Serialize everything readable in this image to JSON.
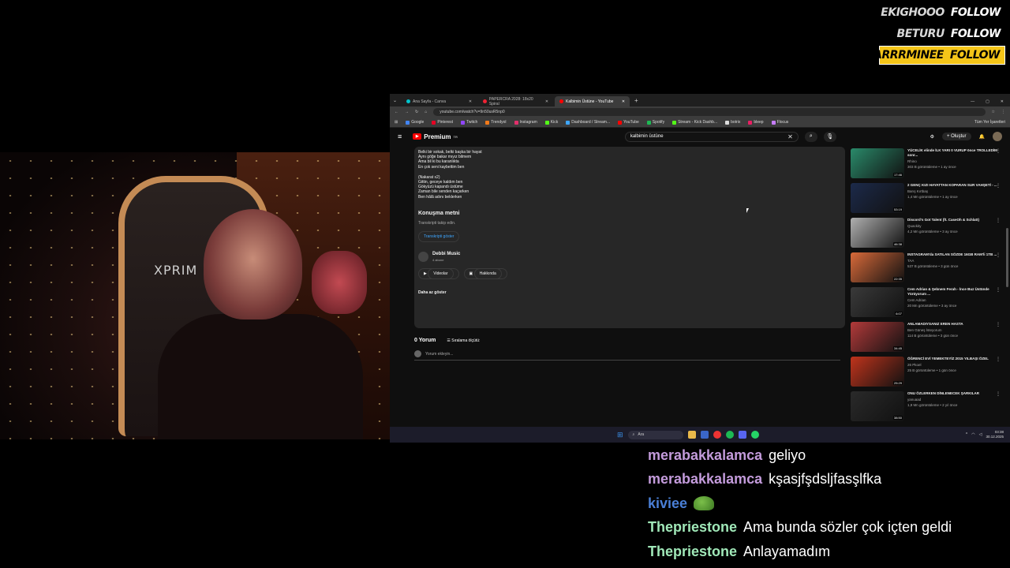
{
  "alerts": [
    {
      "name": "EKIGHOOO",
      "action": "FOLLOW",
      "highlight": false
    },
    {
      "name": "BETURU",
      "action": "FOLLOW",
      "highlight": false
    },
    {
      "name": "NARRRMINEE",
      "action": "FOLLOW",
      "highlight": true
    }
  ],
  "webcam": {
    "chair_brand": "XPRIM"
  },
  "browser": {
    "tabs": [
      {
        "label": "Ana Sayfa - Canva",
        "active": false,
        "color": "#00c4cc"
      },
      {
        "label": "PAPERCRA 2028: 18x20 Spiral",
        "active": false,
        "color": "#e23"
      },
      {
        "label": "Kalbimin Üstüne - YouTube",
        "active": true,
        "color": "#ff0000"
      }
    ],
    "url": "youtube.com/watch?v=9n50usR5np0",
    "bookmarks": [
      {
        "label": "Google",
        "color": "#4285f4"
      },
      {
        "label": "Pinterest",
        "color": "#e60023"
      },
      {
        "label": "Twitch",
        "color": "#9146ff"
      },
      {
        "label": "Trendyol",
        "color": "#f27a1a"
      },
      {
        "label": "Instagram",
        "color": "#e1306c"
      },
      {
        "label": "Kick",
        "color": "#53fc18"
      },
      {
        "label": "Dashboard / Stream...",
        "color": "#3ea6ff"
      },
      {
        "label": "YouTube",
        "color": "#ff0000"
      },
      {
        "label": "Spotify",
        "color": "#1db954"
      },
      {
        "label": "Stream - Kick Dashb...",
        "color": "#53fc18"
      },
      {
        "label": "botrix",
        "color": "#ddd"
      },
      {
        "label": "bleep",
        "color": "#e91e63"
      },
      {
        "label": "Flocus",
        "color": "#c77dff"
      }
    ],
    "bookmarks_right": "Tüm Yer İşaretleri"
  },
  "youtube": {
    "brand": "Premium",
    "brand_sup": "TR",
    "search_value": "kalbimin üstüne",
    "create_label": "Oluştur",
    "lyrics_a": [
      "Belki bir sokak, belki başka bir hayat",
      "Aynı göğe bakar mıyız bilmem",
      "Ama bil ki bu karanlıkta",
      "En çok seni kaybettim ben"
    ],
    "lyrics_b": [
      "(Nakarat x2)",
      "Gittin, geceye kaldım ben",
      "Gökyüzü kapandı üstüme",
      "Zaman bile senden kaçarken",
      "Ben hâlâ adını beklerken"
    ],
    "transcript_heading": "Konuşma metni",
    "transcript_sub": "Transkripti takip edin.",
    "transcript_button": "Transkripti göster",
    "channel_name": "Debbi Music",
    "channel_subs": "4 abone",
    "videos_button": "Videolar",
    "about_button": "Hakkında",
    "show_less": "Daha az göster",
    "comment_count": "0 Yorum",
    "sort_label": "Sıralama ölçütü:",
    "comment_placeholder": "Yorum ekleyin...",
    "side_videos": [
      {
        "title": "YÜCELİK elinde İLK YARI 0 VURUP önce TROLLEDİM sonr...",
        "channel": "Rhino",
        "meta": "303 B görüntüleme • 1 ay önce",
        "duration": "17:46",
        "color": "#2a8a6a"
      },
      {
        "title": "2 GENÇ KIZI HAYATTAN KOPARAN SUR VAHŞETİ - ...",
        "channel": "Barış Kırtbaş",
        "meta": "1,4 Mn görüntüleme • 1 ay önce",
        "duration": "53:19",
        "color": "#1c2a4a"
      },
      {
        "title": "Discord's Got Talent (ft. CaseOh & Schlatt)",
        "channel": "Quackity",
        "meta": "4,2 Mn görüntüleme • 3 ay önce",
        "duration": "46:38",
        "color": "#b0b0b0"
      },
      {
        "title": "INSTAGRAM'da SATILAN SÖZDE 16GB RAM'li 1TB ...",
        "channel": "TAA",
        "meta": "537 B görüntüleme • 3 gün önce",
        "duration": "22:35",
        "color": "#d86a3a"
      },
      {
        "title": "Cem Adrian & Şebnem Ferah - İnce Buz Üstünde Yürüyorum ...",
        "channel": "Cem Adrian",
        "meta": "20 Mn görüntüleme • 3 ay önce",
        "duration": "6:07",
        "color": "#3a3a3a"
      },
      {
        "title": "ANLAMADIYSANIZ EREN HASTA",
        "channel": "Ben Güneş İsteyorum",
        "meta": "114 B görüntüleme • 3 gün önce",
        "duration": "34:45",
        "color": "#b23a3a"
      },
      {
        "title": "ÖĞRENCİ EVİ YEMEKTEYİZ 2015 YILBAŞI ÖZEL",
        "channel": "26 Pkoel",
        "meta": "25 B görüntüleme • 1 gün önce",
        "duration": "25:29",
        "color": "#c0341c"
      },
      {
        "title": "ONU ÖZLERKEN DİNLENECEK ŞARKILAR",
        "channel": "yanuaad",
        "meta": "1,9 Mn görüntüleme • 2 yıl önce",
        "duration": "38:50",
        "color": "#2a2a2a"
      }
    ]
  },
  "taskbar": {
    "search": "Ara",
    "time": "03:38",
    "date": "30.12.2025"
  },
  "chat": [
    {
      "user": "merabakkalamca",
      "color": "#c39bdb",
      "text": "geliyo",
      "emote": false
    },
    {
      "user": "merabakkalamca",
      "color": "#c39bdb",
      "text": "kşasjfşdsljfasşlfka",
      "emote": false
    },
    {
      "user": "kiviee",
      "color": "#4a7fd6",
      "text": "",
      "emote": true
    },
    {
      "user": "Thepriestone",
      "color": "#a0e8b8",
      "text": "Ama bunda sözler çok içten geldi",
      "emote": false
    },
    {
      "user": "Thepriestone",
      "color": "#a0e8b8",
      "text": "Anlayamadım",
      "emote": false
    }
  ]
}
